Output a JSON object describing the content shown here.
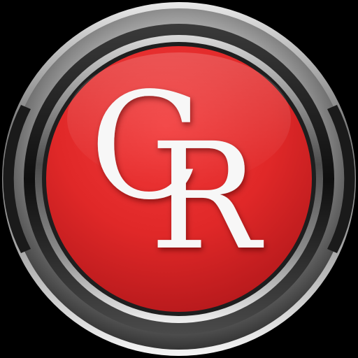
{
  "app_icon": {
    "name": "CR",
    "letter_c": "C",
    "letter_r": "R",
    "colors": {
      "background": "#000000",
      "button_red": "#e22a2a",
      "button_red_dark": "#b3181b",
      "bezel_chrome": "#c9c9c9",
      "bezel_dark": "#2b2b2b",
      "letter_white": "#f7f7f7"
    }
  }
}
